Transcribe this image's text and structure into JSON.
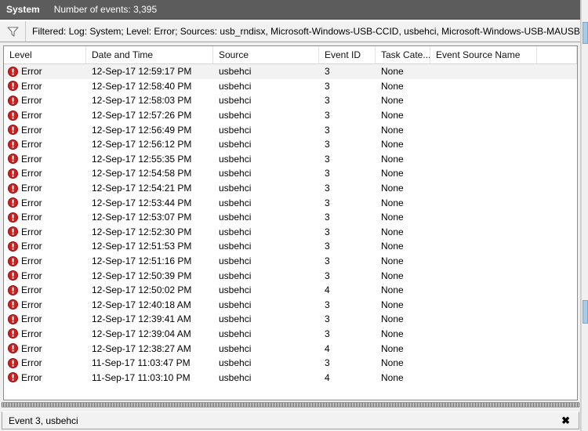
{
  "window": {
    "log_name": "System",
    "event_count_label": "Number of events: 3,395"
  },
  "filter": {
    "icon": "funnel-icon",
    "text": "Filtered: Log: System; Level: Error; Sources: usb_rndisx, Microsoft-Windows-USB-CCID, usbehci, Microsoft-Windows-USB-MAUSBHOST,"
  },
  "table": {
    "columns": [
      {
        "key": "level",
        "label": "Level"
      },
      {
        "key": "date",
        "label": "Date and Time"
      },
      {
        "key": "source",
        "label": "Source"
      },
      {
        "key": "event_id",
        "label": "Event ID"
      },
      {
        "key": "task_category",
        "label": "Task Cate..."
      },
      {
        "key": "event_source_name",
        "label": "Event Source Name"
      }
    ],
    "rows": [
      {
        "level": "Error",
        "level_icon": "error-icon",
        "date": "12-Sep-17 12:59:17 PM",
        "source": "usbehci",
        "event_id": "3",
        "task_category": "None",
        "event_source_name": "",
        "selected": true
      },
      {
        "level": "Error",
        "level_icon": "error-icon",
        "date": "12-Sep-17 12:58:40 PM",
        "source": "usbehci",
        "event_id": "3",
        "task_category": "None",
        "event_source_name": "",
        "selected": false
      },
      {
        "level": "Error",
        "level_icon": "error-icon",
        "date": "12-Sep-17 12:58:03 PM",
        "source": "usbehci",
        "event_id": "3",
        "task_category": "None",
        "event_source_name": "",
        "selected": false
      },
      {
        "level": "Error",
        "level_icon": "error-icon",
        "date": "12-Sep-17 12:57:26 PM",
        "source": "usbehci",
        "event_id": "3",
        "task_category": "None",
        "event_source_name": "",
        "selected": false
      },
      {
        "level": "Error",
        "level_icon": "error-icon",
        "date": "12-Sep-17 12:56:49 PM",
        "source": "usbehci",
        "event_id": "3",
        "task_category": "None",
        "event_source_name": "",
        "selected": false
      },
      {
        "level": "Error",
        "level_icon": "error-icon",
        "date": "12-Sep-17 12:56:12 PM",
        "source": "usbehci",
        "event_id": "3",
        "task_category": "None",
        "event_source_name": "",
        "selected": false
      },
      {
        "level": "Error",
        "level_icon": "error-icon",
        "date": "12-Sep-17 12:55:35 PM",
        "source": "usbehci",
        "event_id": "3",
        "task_category": "None",
        "event_source_name": "",
        "selected": false
      },
      {
        "level": "Error",
        "level_icon": "error-icon",
        "date": "12-Sep-17 12:54:58 PM",
        "source": "usbehci",
        "event_id": "3",
        "task_category": "None",
        "event_source_name": "",
        "selected": false
      },
      {
        "level": "Error",
        "level_icon": "error-icon",
        "date": "12-Sep-17 12:54:21 PM",
        "source": "usbehci",
        "event_id": "3",
        "task_category": "None",
        "event_source_name": "",
        "selected": false
      },
      {
        "level": "Error",
        "level_icon": "error-icon",
        "date": "12-Sep-17 12:53:44 PM",
        "source": "usbehci",
        "event_id": "3",
        "task_category": "None",
        "event_source_name": "",
        "selected": false
      },
      {
        "level": "Error",
        "level_icon": "error-icon",
        "date": "12-Sep-17 12:53:07 PM",
        "source": "usbehci",
        "event_id": "3",
        "task_category": "None",
        "event_source_name": "",
        "selected": false
      },
      {
        "level": "Error",
        "level_icon": "error-icon",
        "date": "12-Sep-17 12:52:30 PM",
        "source": "usbehci",
        "event_id": "3",
        "task_category": "None",
        "event_source_name": "",
        "selected": false
      },
      {
        "level": "Error",
        "level_icon": "error-icon",
        "date": "12-Sep-17 12:51:53 PM",
        "source": "usbehci",
        "event_id": "3",
        "task_category": "None",
        "event_source_name": "",
        "selected": false
      },
      {
        "level": "Error",
        "level_icon": "error-icon",
        "date": "12-Sep-17 12:51:16 PM",
        "source": "usbehci",
        "event_id": "3",
        "task_category": "None",
        "event_source_name": "",
        "selected": false
      },
      {
        "level": "Error",
        "level_icon": "error-icon",
        "date": "12-Sep-17 12:50:39 PM",
        "source": "usbehci",
        "event_id": "3",
        "task_category": "None",
        "event_source_name": "",
        "selected": false
      },
      {
        "level": "Error",
        "level_icon": "error-icon",
        "date": "12-Sep-17 12:50:02 PM",
        "source": "usbehci",
        "event_id": "4",
        "task_category": "None",
        "event_source_name": "",
        "selected": false
      },
      {
        "level": "Error",
        "level_icon": "error-icon",
        "date": "12-Sep-17 12:40:18 AM",
        "source": "usbehci",
        "event_id": "3",
        "task_category": "None",
        "event_source_name": "",
        "selected": false
      },
      {
        "level": "Error",
        "level_icon": "error-icon",
        "date": "12-Sep-17 12:39:41 AM",
        "source": "usbehci",
        "event_id": "3",
        "task_category": "None",
        "event_source_name": "",
        "selected": false
      },
      {
        "level": "Error",
        "level_icon": "error-icon",
        "date": "12-Sep-17 12:39:04 AM",
        "source": "usbehci",
        "event_id": "3",
        "task_category": "None",
        "event_source_name": "",
        "selected": false
      },
      {
        "level": "Error",
        "level_icon": "error-icon",
        "date": "12-Sep-17 12:38:27 AM",
        "source": "usbehci",
        "event_id": "4",
        "task_category": "None",
        "event_source_name": "",
        "selected": false
      },
      {
        "level": "Error",
        "level_icon": "error-icon",
        "date": "11-Sep-17 11:03:47 PM",
        "source": "usbehci",
        "event_id": "3",
        "task_category": "None",
        "event_source_name": "",
        "selected": false
      },
      {
        "level": "Error",
        "level_icon": "error-icon",
        "date": "11-Sep-17 11:03:10 PM",
        "source": "usbehci",
        "event_id": "4",
        "task_category": "None",
        "event_source_name": "",
        "selected": false
      }
    ]
  },
  "status_bar": {
    "text": "Event 3, usbehci",
    "close_label": "✖"
  },
  "colors": {
    "header_bar": "#5c5c5c",
    "error_red": "#cc1f1f",
    "selection": "#f2f2f2",
    "scroll_thumb": "#a6cbe8"
  }
}
